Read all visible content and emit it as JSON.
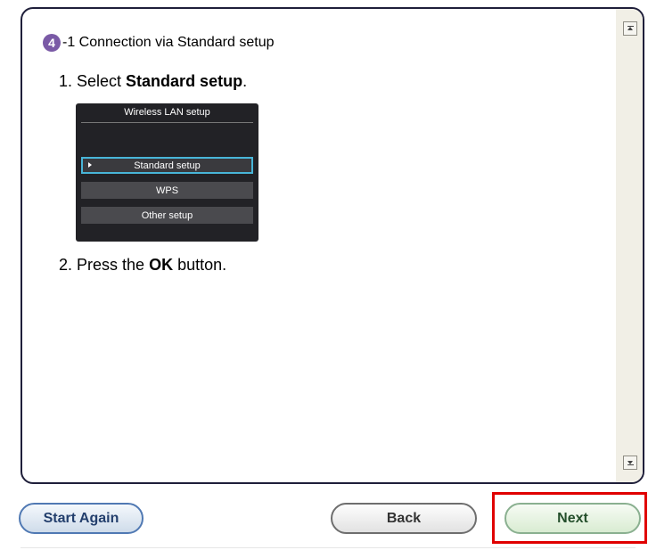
{
  "heading": {
    "step_number": "4",
    "text": "-1 Connection via Standard setup"
  },
  "instruction1": {
    "prefix": "1. Select ",
    "bold": "Standard setup",
    "suffix": "."
  },
  "printer_screen": {
    "title": "Wireless LAN setup",
    "options": [
      {
        "label": "Standard setup",
        "selected": true
      },
      {
        "label": "WPS",
        "selected": false
      },
      {
        "label": "Other setup",
        "selected": false
      }
    ]
  },
  "instruction2": {
    "prefix": "2. Press the ",
    "bold": "OK",
    "suffix": " button."
  },
  "buttons": {
    "start_again": "Start Again",
    "back": "Back",
    "next": "Next"
  },
  "colors": {
    "highlight": "#e00000",
    "step_badge": "#7a5aa6",
    "selection": "#48b5d8"
  }
}
